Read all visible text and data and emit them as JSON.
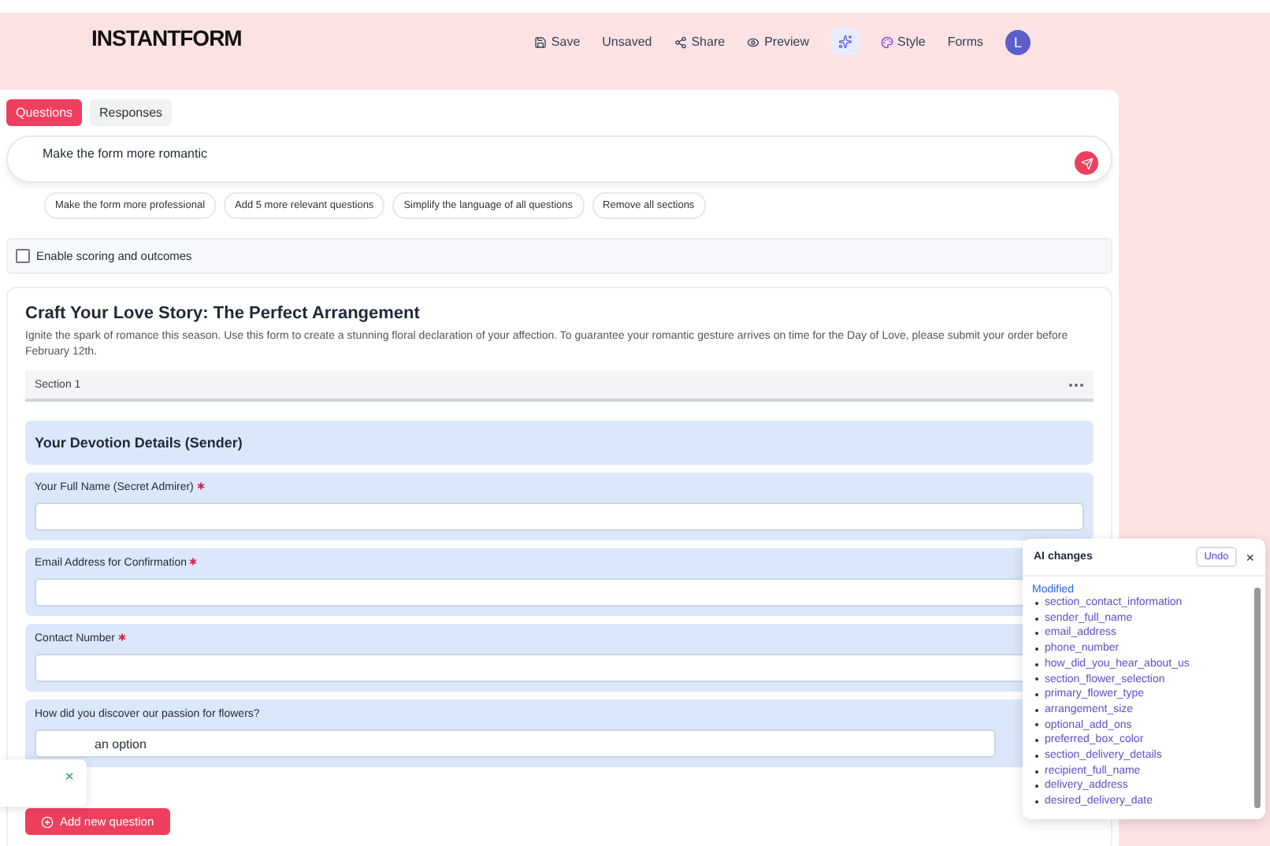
{
  "header": {
    "logo": "INSTANTFORM",
    "save": "Save",
    "status": "Unsaved",
    "share": "Share",
    "preview": "Preview",
    "ai_button_active": true,
    "style": "Style",
    "forms": "Forms",
    "avatar": "L"
  },
  "tabs": [
    {
      "label": "Questions",
      "selected": true
    },
    {
      "label": "Responses",
      "selected": false
    }
  ],
  "prompt": {
    "value": "Make the form more romantic"
  },
  "suggestions": [
    "Make the form more professional",
    "Add 5 more relevant questions",
    "Simplify the language of all questions",
    "Remove all sections"
  ],
  "scoring": {
    "label": "Enable scoring and outcomes",
    "checked": false
  },
  "form": {
    "title": "Craft Your Love Story: The Perfect Arrangement",
    "description": "Ignite the spark of romance this season. Use this form to create a stunning floral declaration of your affection. To guarantee your romantic gesture arrives on time for the Day of Love, please submit your order before February 12th.",
    "section": "Section 1",
    "heading": "Your Devotion Details (Sender)",
    "questions": [
      {
        "label": "Your Full Name (Secret Admirer)",
        "required": true,
        "kind": "text"
      },
      {
        "label": "Email Address for Confirmation",
        "required": true,
        "kind": "text"
      },
      {
        "label": "Contact Number",
        "required": true,
        "kind": "text"
      },
      {
        "label": "How did you discover our passion for flowers?",
        "required": false,
        "kind": "select",
        "value": "an option"
      }
    ],
    "add_button": "Add new question"
  },
  "ai_changes": {
    "title": "AI changes",
    "undo": "Undo",
    "close": "×",
    "group": "Modified",
    "items": [
      "section_contact_information",
      "sender_full_name",
      "email_address",
      "phone_number",
      "how_did_you_hear_about_us",
      "section_flower_selection",
      "primary_flower_type",
      "arrangement_size",
      "optional_add_ons",
      "preferred_box_color",
      "section_delivery_details",
      "recipient_full_name",
      "delivery_address",
      "desired_delivery_date"
    ]
  },
  "toast": {
    "close": "×"
  }
}
